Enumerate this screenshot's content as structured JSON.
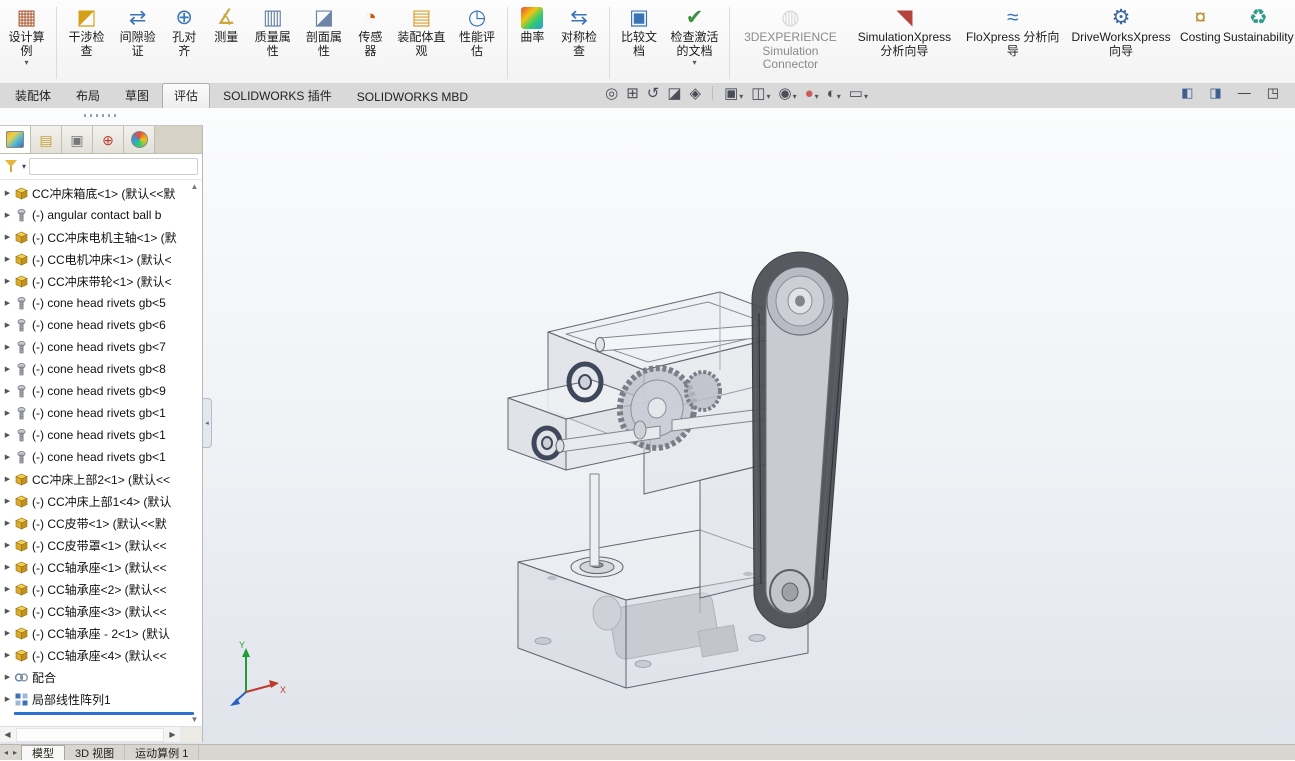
{
  "colors": {
    "selection_blue": "#2a6fd2",
    "rollback_bar": "#2a6fd2",
    "viewport_top": "#fbfcfd",
    "viewport_bottom": "#e0e4eb"
  },
  "ribbon": {
    "buttons": [
      {
        "label": "设计算例",
        "icon": "design-study-icon",
        "dropdown": true
      },
      {
        "label": "干涉检查",
        "icon": "interference-check-icon",
        "sep_before": true
      },
      {
        "label": "间隙验证",
        "icon": "clearance-verification-icon"
      },
      {
        "label": "孔对齐",
        "icon": "hole-alignment-icon"
      },
      {
        "label": "测量",
        "icon": "measure-icon"
      },
      {
        "label": "质量属性",
        "icon": "mass-properties-icon"
      },
      {
        "label": "剖面属性",
        "icon": "section-properties-icon"
      },
      {
        "label": "传感器",
        "icon": "sensors-icon"
      },
      {
        "label": "装配体直观",
        "icon": "assembly-visualization-icon"
      },
      {
        "label": "性能评估",
        "icon": "performance-evaluation-icon"
      },
      {
        "label": "曲率",
        "icon": "curvature-icon",
        "sep_before": true
      },
      {
        "label": "对称检查",
        "icon": "symmetry-check-icon"
      },
      {
        "label": "比较文档",
        "icon": "compare-documents-icon",
        "sep_before": true
      },
      {
        "label": "检查激活的文档",
        "icon": "check-active-document-icon",
        "dropdown": true
      },
      {
        "label": "3DEXPERIENCE Simulation Connector",
        "icon": "threedexperience-connector-icon",
        "disabled": true,
        "sep_before": true
      },
      {
        "label": "SimulationXpress 分析向导",
        "icon": "simulationxpress-icon"
      },
      {
        "label": "FloXpress 分析向导",
        "icon": "floxpress-icon"
      },
      {
        "label": "DriveWorksXpress 向导",
        "icon": "driveworksxpress-icon"
      },
      {
        "label": "Costing",
        "icon": "costing-icon"
      },
      {
        "label": "Sustainability",
        "icon": "sustainability-icon"
      }
    ]
  },
  "command_tabs": {
    "items": [
      "装配体",
      "布局",
      "草图",
      "评估",
      "SOLIDWORKS 插件",
      "SOLIDWORKS MBD"
    ],
    "active_index": 3
  },
  "viewbar": {
    "items": [
      {
        "icon": "zoom-fit-icon"
      },
      {
        "icon": "zoom-area-icon"
      },
      {
        "icon": "previous-view-icon"
      },
      {
        "icon": "section-view-icon"
      },
      {
        "icon": "dynamic-annotation-icon"
      },
      {
        "icon": "view-orientation-icon",
        "dropdown": true,
        "sep_before": true
      },
      {
        "icon": "display-style-icon",
        "dropdown": true
      },
      {
        "icon": "hide-show-items-icon",
        "dropdown": true
      },
      {
        "icon": "edit-appearance-icon",
        "dropdown": true
      },
      {
        "icon": "apply-scene-icon",
        "dropdown": true
      },
      {
        "icon": "view-settings-icon",
        "dropdown": true
      }
    ]
  },
  "window_controls": [
    {
      "icon": "pane-left-icon"
    },
    {
      "icon": "pane-right-icon"
    },
    {
      "icon": "minimize-window-icon"
    },
    {
      "icon": "restore-window-icon"
    }
  ],
  "panel": {
    "tabs": [
      {
        "icon": "featuremanager-tab-icon",
        "active": true
      },
      {
        "icon": "propertymanager-tab-icon"
      },
      {
        "icon": "configurationmanager-tab-icon"
      },
      {
        "icon": "dimxpertmanager-tab-icon"
      },
      {
        "icon": "displaymanager-tab-icon"
      }
    ],
    "filter": {
      "placeholder": ""
    }
  },
  "tree": {
    "items": [
      {
        "label": "CC冲床箱底<1> (默认<<默",
        "icon": "part-icon"
      },
      {
        "label": "(-) angular contact ball b",
        "icon": "fastener-icon"
      },
      {
        "label": "(-) CC冲床电机主轴<1> (默",
        "icon": "part-icon"
      },
      {
        "label": "(-) CC电机冲床<1> (默认<",
        "icon": "part-icon"
      },
      {
        "label": "(-) CC冲床带轮<1> (默认<",
        "icon": "part-icon"
      },
      {
        "label": "(-) cone head rivets gb<5",
        "icon": "fastener-icon"
      },
      {
        "label": "(-) cone head rivets gb<6",
        "icon": "fastener-icon"
      },
      {
        "label": "(-) cone head rivets gb<7",
        "icon": "fastener-icon"
      },
      {
        "label": "(-) cone head rivets gb<8",
        "icon": "fastener-icon"
      },
      {
        "label": "(-) cone head rivets gb<9",
        "icon": "fastener-icon"
      },
      {
        "label": "(-) cone head rivets gb<1",
        "icon": "fastener-icon"
      },
      {
        "label": "(-) cone head rivets gb<1",
        "icon": "fastener-icon"
      },
      {
        "label": "(-) cone head rivets gb<1",
        "icon": "fastener-icon"
      },
      {
        "label": "CC冲床上部2<1> (默认<<",
        "icon": "part-icon"
      },
      {
        "label": "(-) CC冲床上部1<4> (默认",
        "icon": "part-icon"
      },
      {
        "label": "(-) CC皮带<1> (默认<<默",
        "icon": "part-icon"
      },
      {
        "label": "(-) CC皮带罩<1> (默认<<",
        "icon": "part-icon"
      },
      {
        "label": "(-) CC轴承座<1> (默认<<",
        "icon": "part-icon"
      },
      {
        "label": "(-) CC轴承座<2> (默认<<",
        "icon": "part-icon"
      },
      {
        "label": "(-) CC轴承座<3> (默认<<",
        "icon": "part-icon"
      },
      {
        "label": "(-) CC轴承座 - 2<1> (默认",
        "icon": "part-icon"
      },
      {
        "label": "(-) CC轴承座<4> (默认<<",
        "icon": "part-icon"
      },
      {
        "label": "配合",
        "icon": "mates-icon"
      },
      {
        "label": "局部线性阵列1",
        "icon": "pattern-icon"
      }
    ]
  },
  "bottom": {
    "nav_icons": [
      "scroll-tabs-left-icon",
      "scroll-tabs-right-icon"
    ],
    "tabs": [
      {
        "label": "模型",
        "active": true
      },
      {
        "label": "3D 视图"
      },
      {
        "label": "运动算例 1"
      }
    ]
  },
  "triad": {
    "axis_x_label": "X",
    "axis_y_label": "Y"
  }
}
